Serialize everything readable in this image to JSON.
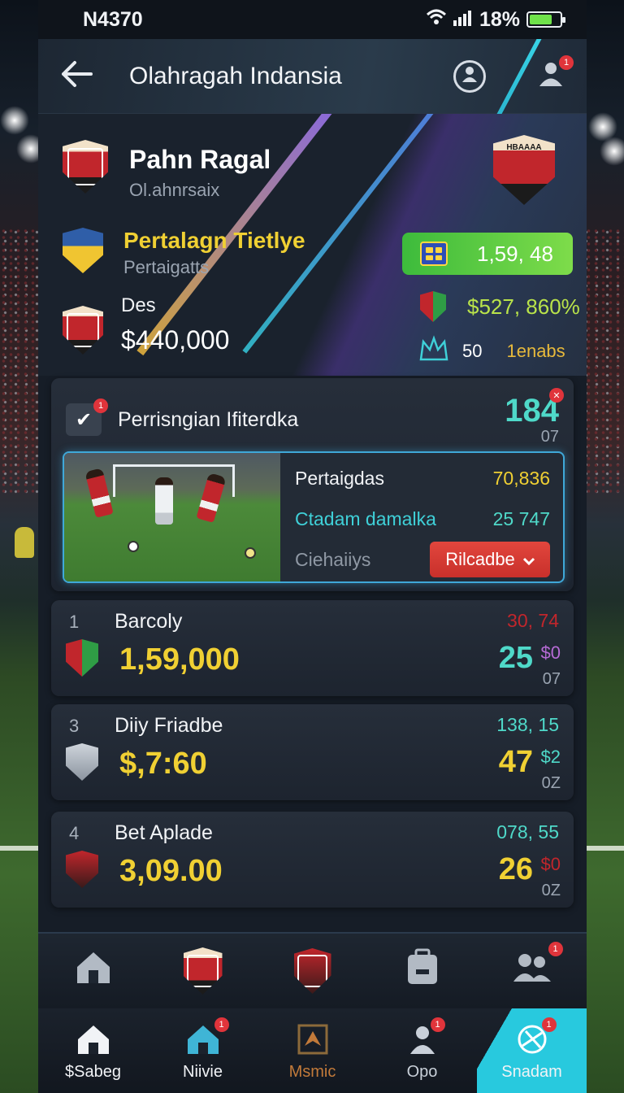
{
  "status_bar": {
    "carrier": "N4370",
    "battery_percent": "18%",
    "battery_fill": 0.75
  },
  "header": {
    "title": "Olahragah Indansia",
    "back_icon": "arrow-left-icon",
    "search_icon": "search-user-icon",
    "notifications_icon": "user-alert-icon",
    "notifications_badge": "1"
  },
  "hero": {
    "team_name": "Pahn Ragal",
    "team_subtitle": "Ol.ahnrsaix",
    "league_name": "Pertalagn Tietlye",
    "league_subtitle": "Pertaigatts",
    "des_label": "Des",
    "des_value": "$440,000",
    "badge_value": "1,59, 48",
    "stat_value": "$527, 860%",
    "small_count": "50",
    "small_label": "1enabs",
    "crest_text": "HBAAAA"
  },
  "featured": {
    "title": "Perrisngian Ifiterdka",
    "score": "184",
    "score_sub": "07",
    "badge": "1",
    "rows": [
      {
        "label": "Pertaigdas",
        "value": "70,836"
      },
      {
        "label": "Ctadam damalka",
        "value": "25 747"
      },
      {
        "label": "Ciehaiiys",
        "button": "Rilcadbe"
      }
    ]
  },
  "list": [
    {
      "rank": "1",
      "name": "Barcoly",
      "value": "1,59,000",
      "top": "30, 74",
      "score": "25",
      "badge": "$0",
      "small": "07",
      "value_color": "#f0d033",
      "top_color": "#c1262c",
      "score_color": "#4fd9c9",
      "badge_color": "#b76bd6"
    },
    {
      "rank": "3",
      "name": "Diiy Friadbe",
      "value": "$,7:60",
      "top": "138, 15",
      "score": "47",
      "badge": "$2",
      "small": "0Z",
      "value_color": "#f0d033",
      "top_color": "#4fd9c9",
      "score_color": "#f0d033",
      "badge_color": "#4fd9c9"
    },
    {
      "rank": "4",
      "name": "Bet Aplade",
      "value": "3,09.00",
      "top": "078, 55",
      "score": "26",
      "badge": "$0",
      "small": "0Z",
      "value_color": "#f0d033",
      "top_color": "#4fd9c9",
      "score_color": "#f0d033",
      "badge_color": "#c1262c"
    }
  ],
  "quickbar": [
    "home-icon",
    "club-crest-icon",
    "shield-crest-icon",
    "briefcase-icon",
    "users-icon"
  ],
  "bottom_nav": [
    {
      "label": "$Sabeg",
      "icon": "home-icon",
      "color": "#f1f3f6"
    },
    {
      "label": "Niivie",
      "icon": "home-outline-icon",
      "color": "#f1f3f6",
      "badge": "1"
    },
    {
      "label": "Msmic",
      "icon": "trophy-icon",
      "color": "#c27a3a"
    },
    {
      "label": "Opo",
      "icon": "user-icon",
      "color": "#c9d0d9",
      "badge": "1"
    },
    {
      "label": "Snadam",
      "icon": "ball-icon",
      "color": "#f1f3f6",
      "badge": "1"
    }
  ]
}
